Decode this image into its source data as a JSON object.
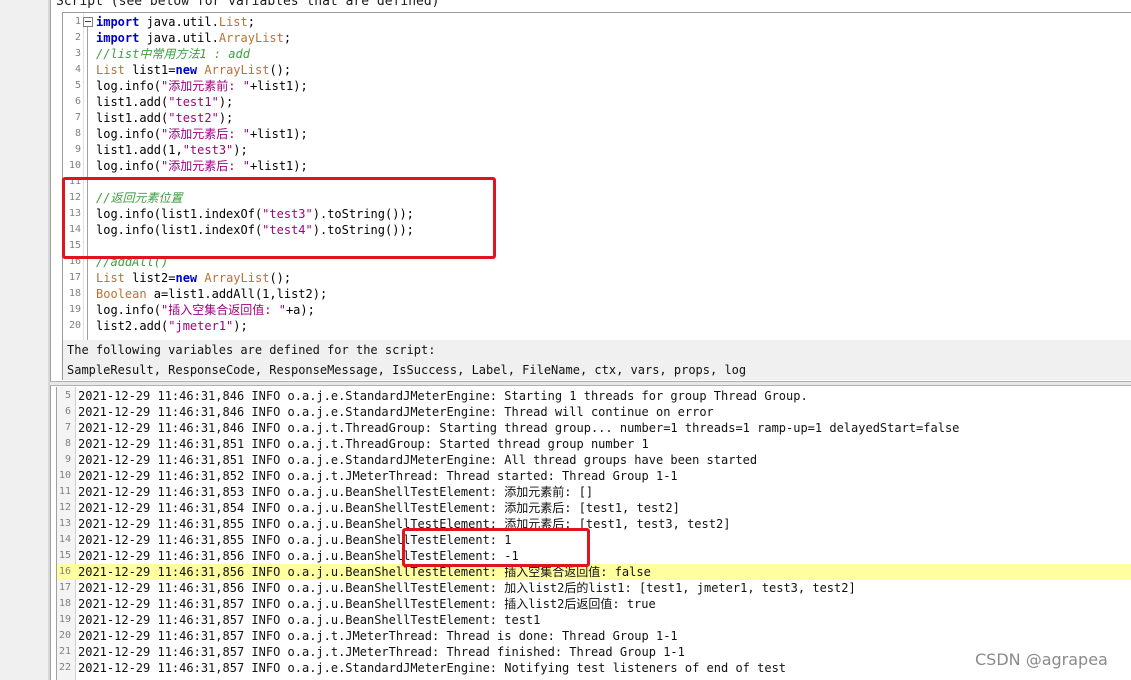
{
  "panel_title": "Script (see below for variables that are defined)",
  "script_lines": [
    {
      "n": "1",
      "parts": [
        {
          "t": "import",
          "c": "kw"
        },
        {
          "t": " java.util.",
          "c": ""
        },
        {
          "t": "List",
          "c": "ty"
        },
        {
          "t": ";",
          "c": ""
        }
      ]
    },
    {
      "n": "2",
      "parts": [
        {
          "t": "import",
          "c": "kw"
        },
        {
          "t": " java.util.",
          "c": ""
        },
        {
          "t": "ArrayList",
          "c": "ty"
        },
        {
          "t": ";",
          "c": ""
        }
      ]
    },
    {
      "n": "3",
      "parts": [
        {
          "t": "//list中常用方法1 : add",
          "c": "cm"
        }
      ]
    },
    {
      "n": "4",
      "parts": [
        {
          "t": "List",
          "c": "ty"
        },
        {
          "t": " list1=",
          "c": ""
        },
        {
          "t": "new",
          "c": "kw"
        },
        {
          "t": " ",
          "c": ""
        },
        {
          "t": "ArrayList",
          "c": "ty"
        },
        {
          "t": "();",
          "c": ""
        }
      ]
    },
    {
      "n": "5",
      "parts": [
        {
          "t": "log.info(",
          "c": ""
        },
        {
          "t": "\"添加元素前: \"",
          "c": "st"
        },
        {
          "t": "+list1);",
          "c": ""
        }
      ]
    },
    {
      "n": "6",
      "parts": [
        {
          "t": "list1.add(",
          "c": ""
        },
        {
          "t": "\"test1\"",
          "c": "st"
        },
        {
          "t": ");",
          "c": ""
        }
      ]
    },
    {
      "n": "7",
      "parts": [
        {
          "t": "list1.add(",
          "c": ""
        },
        {
          "t": "\"test2\"",
          "c": "st"
        },
        {
          "t": ");",
          "c": ""
        }
      ]
    },
    {
      "n": "8",
      "parts": [
        {
          "t": "log.info(",
          "c": ""
        },
        {
          "t": "\"添加元素后: \"",
          "c": "st"
        },
        {
          "t": "+list1);",
          "c": ""
        }
      ]
    },
    {
      "n": "9",
      "parts": [
        {
          "t": "list1.add(1,",
          "c": ""
        },
        {
          "t": "\"test3\"",
          "c": "st"
        },
        {
          "t": ");",
          "c": ""
        }
      ]
    },
    {
      "n": "10",
      "parts": [
        {
          "t": "log.info(",
          "c": ""
        },
        {
          "t": "\"添加元素后: \"",
          "c": "st"
        },
        {
          "t": "+list1);",
          "c": ""
        }
      ]
    },
    {
      "n": "11",
      "parts": []
    },
    {
      "n": "12",
      "parts": [
        {
          "t": "//返回元素位置",
          "c": "cm"
        }
      ]
    },
    {
      "n": "13",
      "parts": [
        {
          "t": "log.info(list1.indexOf(",
          "c": ""
        },
        {
          "t": "\"test3\"",
          "c": "st"
        },
        {
          "t": ").toString());",
          "c": ""
        }
      ]
    },
    {
      "n": "14",
      "parts": [
        {
          "t": "log.info(list1.indexOf(",
          "c": ""
        },
        {
          "t": "\"test4\"",
          "c": "st"
        },
        {
          "t": ").toString());",
          "c": ""
        }
      ]
    },
    {
      "n": "15",
      "parts": []
    },
    {
      "n": "16",
      "parts": [
        {
          "t": "//addAll()",
          "c": "cm"
        }
      ]
    },
    {
      "n": "17",
      "parts": [
        {
          "t": "List",
          "c": "ty"
        },
        {
          "t": " list2=",
          "c": ""
        },
        {
          "t": "new",
          "c": "kw"
        },
        {
          "t": " ",
          "c": ""
        },
        {
          "t": "ArrayList",
          "c": "ty"
        },
        {
          "t": "();",
          "c": ""
        }
      ]
    },
    {
      "n": "18",
      "parts": [
        {
          "t": "Boolean",
          "c": "ty"
        },
        {
          "t": " a=list1.addAll(1,list2);",
          "c": ""
        }
      ]
    },
    {
      "n": "19",
      "parts": [
        {
          "t": "log.info(",
          "c": ""
        },
        {
          "t": "\"插入空集合返回值: \"",
          "c": "st"
        },
        {
          "t": "+a);",
          "c": ""
        }
      ]
    },
    {
      "n": "20",
      "parts": [
        {
          "t": "list2.add(",
          "c": ""
        },
        {
          "t": "\"jmeter1\"",
          "c": "st"
        },
        {
          "t": ");",
          "c": ""
        }
      ]
    }
  ],
  "vars_header": "The following variables are defined for the script:",
  "vars_list": "SampleResult, ResponseCode, ResponseMessage, IsSuccess, Label, FileName, ctx, vars, props, log",
  "log_lines": [
    {
      "n": "5",
      "text": "2021-12-29 11:46:31,846 INFO o.a.j.e.StandardJMeterEngine: Starting 1 threads for group Thread Group."
    },
    {
      "n": "6",
      "text": "2021-12-29 11:46:31,846 INFO o.a.j.e.StandardJMeterEngine: Thread will continue on error"
    },
    {
      "n": "7",
      "text": "2021-12-29 11:46:31,846 INFO o.a.j.t.ThreadGroup: Starting thread group... number=1 threads=1 ramp-up=1 delayedStart=false"
    },
    {
      "n": "8",
      "text": "2021-12-29 11:46:31,851 INFO o.a.j.t.ThreadGroup: Started thread group number 1"
    },
    {
      "n": "9",
      "text": "2021-12-29 11:46:31,851 INFO o.a.j.e.StandardJMeterEngine: All thread groups have been started"
    },
    {
      "n": "10",
      "text": "2021-12-29 11:46:31,852 INFO o.a.j.t.JMeterThread: Thread started: Thread Group 1-1"
    },
    {
      "n": "11",
      "text": "2021-12-29 11:46:31,853 INFO o.a.j.u.BeanShellTestElement: 添加元素前: []"
    },
    {
      "n": "12",
      "text": "2021-12-29 11:46:31,854 INFO o.a.j.u.BeanShellTestElement: 添加元素后: [test1, test2]"
    },
    {
      "n": "13",
      "text": "2021-12-29 11:46:31,855 INFO o.a.j.u.BeanShellTestElement: 添加元素后: [test1, test3, test2]"
    },
    {
      "n": "14",
      "text": "2021-12-29 11:46:31,855 INFO o.a.j.u.BeanShellTestElement: 1"
    },
    {
      "n": "15",
      "text": "2021-12-29 11:46:31,856 INFO o.a.j.u.BeanShellTestElement: -1"
    },
    {
      "n": "16",
      "text": "2021-12-29 11:46:31,856 INFO o.a.j.u.BeanShellTestElement: 插入空集合返回值: false"
    },
    {
      "n": "17",
      "text": "2021-12-29 11:46:31,856 INFO o.a.j.u.BeanShellTestElement: 加入list2后的list1: [test1, jmeter1, test3, test2]"
    },
    {
      "n": "18",
      "text": "2021-12-29 11:46:31,857 INFO o.a.j.u.BeanShellTestElement: 插入list2后返回值: true"
    },
    {
      "n": "19",
      "text": "2021-12-29 11:46:31,857 INFO o.a.j.u.BeanShellTestElement: test1"
    },
    {
      "n": "20",
      "text": "2021-12-29 11:46:31,857 INFO o.a.j.t.JMeterThread: Thread is done: Thread Group 1-1"
    },
    {
      "n": "21",
      "text": "2021-12-29 11:46:31,857 INFO o.a.j.t.JMeterThread: Thread finished: Thread Group 1-1"
    },
    {
      "n": "22",
      "text": "2021-12-29 11:46:31,857 INFO o.a.j.e.StandardJMeterEngine: Notifying test listeners of end of test"
    }
  ],
  "highlighted_log_line": "16",
  "colors": {
    "keyword": "#0000cc",
    "type": "#b87333",
    "comment": "#3f9f3f",
    "string": "#a00080",
    "highlight": "#ffffa0",
    "annotation_box": "#e0141e"
  },
  "watermark": "CSDN @agrapea"
}
